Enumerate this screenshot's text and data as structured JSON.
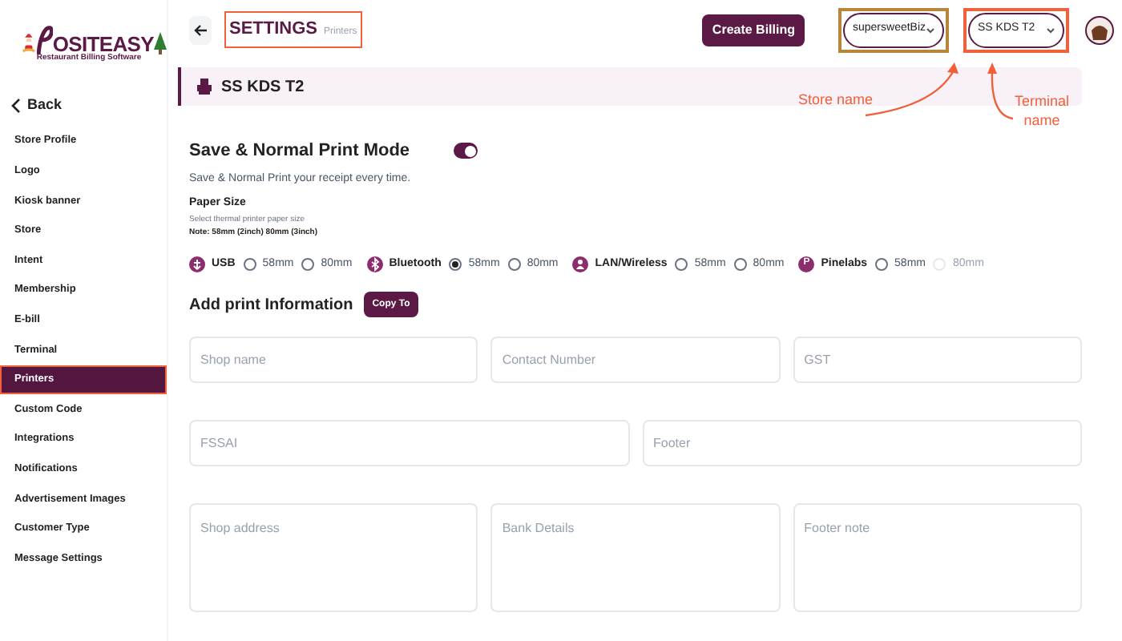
{
  "logo": {
    "name": "OSITEASY",
    "tagline": "Restaurant Billing Software"
  },
  "sidebar": {
    "back": "Back",
    "items": [
      {
        "label": "Store Profile",
        "selected": false
      },
      {
        "label": "Logo",
        "selected": false
      },
      {
        "label": "Kiosk banner",
        "selected": false
      },
      {
        "label": "Store",
        "selected": false
      },
      {
        "label": "Intent",
        "selected": false
      },
      {
        "label": "Membership",
        "selected": false
      },
      {
        "label": "E-bill",
        "selected": false
      },
      {
        "label": "Terminal",
        "selected": false
      },
      {
        "label": "Printers",
        "selected": true
      },
      {
        "label": "Custom Code",
        "selected": false
      },
      {
        "label": "Integrations",
        "selected": false
      },
      {
        "label": "Notifications",
        "selected": false
      },
      {
        "label": "Advertisement Images",
        "selected": false
      },
      {
        "label": "Customer Type",
        "selected": false
      },
      {
        "label": "Message Settings",
        "selected": false
      }
    ]
  },
  "header": {
    "title": "SETTINGS",
    "subtitle": "Printers",
    "create_button": "Create Billing",
    "store_select": "supersweetBiz",
    "terminal_select": "SS KDS T2"
  },
  "banner": {
    "title": "SS KDS T2"
  },
  "print_mode": {
    "title": "Save & Normal Print Mode",
    "on": true,
    "description": "Save & Normal Print your receipt every time."
  },
  "paper_size": {
    "title": "Paper Size",
    "hint": "Select thermal printer paper size",
    "note": "Note: 58mm (2inch) 80mm (3inch)"
  },
  "printers": [
    {
      "kind": "usb",
      "label": "USB",
      "options": [
        {
          "label": "58mm",
          "selected": false,
          "disabled": false
        },
        {
          "label": "80mm",
          "selected": false,
          "disabled": false
        }
      ]
    },
    {
      "kind": "bluetooth",
      "label": "Bluetooth",
      "options": [
        {
          "label": "58mm",
          "selected": true,
          "disabled": false
        },
        {
          "label": "80mm",
          "selected": false,
          "disabled": false
        }
      ]
    },
    {
      "kind": "lan",
      "label": "LAN/Wireless",
      "options": [
        {
          "label": "58mm",
          "selected": false,
          "disabled": false
        },
        {
          "label": "80mm",
          "selected": false,
          "disabled": false
        }
      ]
    },
    {
      "kind": "letter",
      "glyph": "P",
      "label": "Pinelabs",
      "options": [
        {
          "label": "58mm",
          "selected": false,
          "disabled": false
        },
        {
          "label": "80mm",
          "selected": false,
          "disabled": true
        }
      ]
    }
  ],
  "print_info": {
    "title": "Add print Information",
    "copy_button": "Copy To",
    "rows": [
      {
        "kind": "short",
        "fields": [
          {
            "placeholder": "Shop name"
          },
          {
            "placeholder": "Contact Number"
          },
          {
            "placeholder": "GST"
          }
        ]
      },
      {
        "kind": "short",
        "fields": [
          {
            "placeholder": "FSSAI"
          },
          {
            "placeholder": "Footer"
          }
        ]
      },
      {
        "kind": "tall",
        "fields": [
          {
            "placeholder": "Shop address"
          },
          {
            "placeholder": "Bank Details"
          },
          {
            "placeholder": "Footer note"
          }
        ]
      }
    ]
  },
  "annotations": [
    {
      "text": "Store name"
    },
    {
      "text": "Terminal name"
    }
  ]
}
